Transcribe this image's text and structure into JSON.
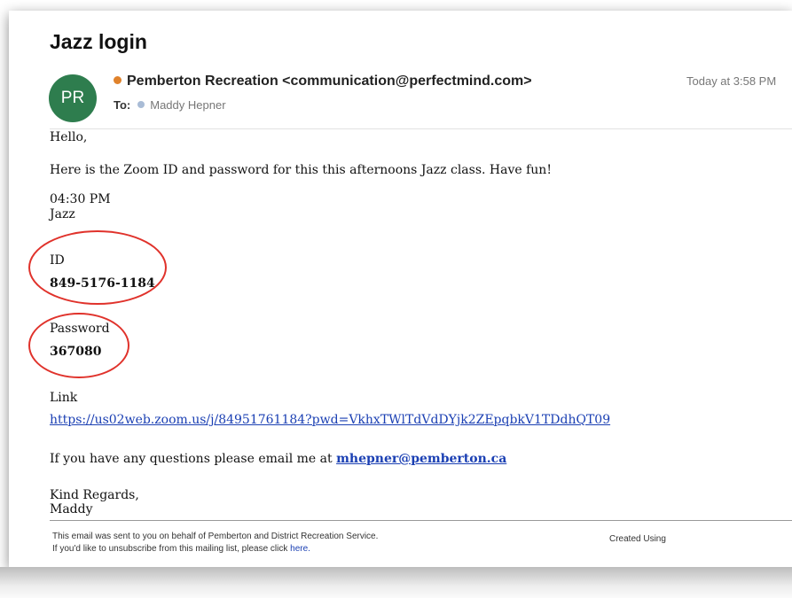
{
  "email": {
    "subject": "Jazz login",
    "avatar_initials": "PR",
    "sender": "Pemberton Recreation  <communication@perfectmind.com>",
    "to_label": "To:",
    "recipient": "Maddy Hepner",
    "time": "Today at 3:58 PM"
  },
  "body": {
    "greeting": "Hello,",
    "intro": "Here is the Zoom ID and password for this this afternoons Jazz class. Have fun!",
    "class_time": "04:30 PM",
    "class_name": "Jazz",
    "id_label": "ID",
    "id_value": "849-5176-1184",
    "password_label": "Password",
    "password_value": "367080",
    "link_label": "Link",
    "link_url": "https://us02web.zoom.us/j/84951761184?pwd=VkhxTWlTdVdDYjk2ZEpqbkV1TDdhQT09",
    "questions_text": "If you have any questions please email me at",
    "contact_email": "mhepner@pemberton.ca",
    "signoff": "Kind Regards,",
    "signature": "Maddy"
  },
  "footer": {
    "line1": "This email was sent to you on behalf of Pemberton and District Recreation Service.",
    "line2": "If you'd like to unsubscribe from this mailing list, please click",
    "unsubscribe_link": "here.",
    "created_using": "Created Using"
  },
  "colors": {
    "avatar": "#2e7d4e",
    "annotation_circle": "#e0322b",
    "link": "#1a3fb3"
  }
}
